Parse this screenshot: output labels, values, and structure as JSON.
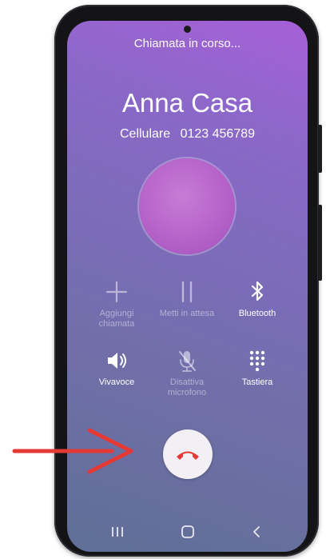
{
  "call": {
    "status": "Chiamata in corso...",
    "contact_name": "Anna Casa",
    "number_type": "Cellulare",
    "number": "0123 456789"
  },
  "controls": [
    {
      "name": "add-call",
      "label": "Aggiungi chiamata",
      "icon": "plus-icon",
      "enabled": false
    },
    {
      "name": "hold",
      "label": "Metti in attesa",
      "icon": "pause-icon",
      "enabled": false
    },
    {
      "name": "bluetooth",
      "label": "Bluetooth",
      "icon": "bluetooth-icon",
      "enabled": true
    },
    {
      "name": "speaker",
      "label": "Vivavoce",
      "icon": "speaker-icon",
      "enabled": true
    },
    {
      "name": "mute",
      "label": "Disattiva microfono",
      "icon": "mic-off-icon",
      "enabled": false
    },
    {
      "name": "keypad",
      "label": "Tastiera",
      "icon": "keypad-icon",
      "enabled": true
    }
  ],
  "end_call": {
    "icon": "end-call-icon",
    "color": "#e53935"
  },
  "navbar": [
    "recent-apps-icon",
    "home-icon",
    "back-icon"
  ],
  "annotation": {
    "arrow_color": "#e53935"
  }
}
